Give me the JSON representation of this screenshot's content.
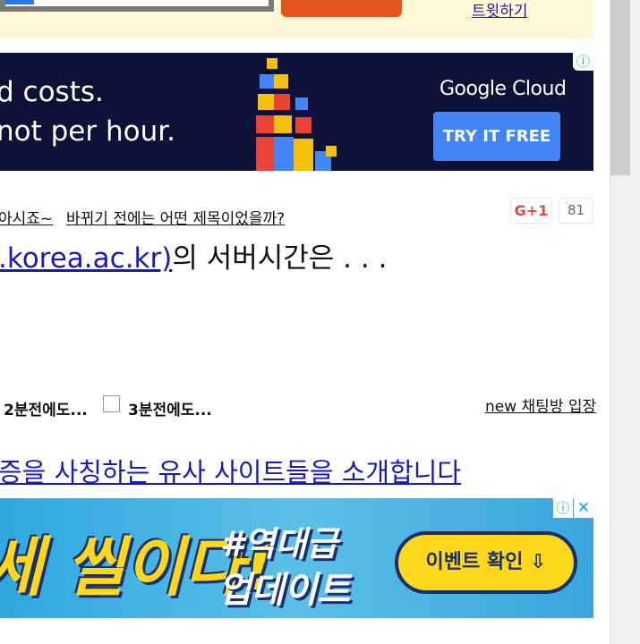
{
  "topbar": {
    "tweet": "트윗하기"
  },
  "google_ad": {
    "line1": "d costs.",
    "line2": "not per hour.",
    "logo": "Google Cloud",
    "cta": "TRY IT FREE",
    "info_icon": "info-icon"
  },
  "titles": {
    "prev": "아시죠~",
    "question": "바뀌기 전에는 어떤 제목이었을까?",
    "gplus": "G+1",
    "gplus_count": "81",
    "headline_link": ".korea.ac.kr)",
    "headline_rest": "의 서버시간은 . . ."
  },
  "options": {
    "two_min": "2분전에도...",
    "three_min": "3분전에도...",
    "chat": "new 채팅방 입장"
  },
  "intro": "증을 사칭하는 유사 사이트들을 소개합니다",
  "game_ad": {
    "big": "세 씰이다!",
    "tag1": "#역대급",
    "tag2": "업데이트",
    "cta": "이벤트 확인 ⇩",
    "info_icon": "info-icon",
    "close_icon": "close-icon"
  },
  "colors": {
    "link": "#1a1ab8",
    "ad_bg": "#0f1238",
    "cta_blue": "#4285f4",
    "topbar": "#fff8d6"
  }
}
